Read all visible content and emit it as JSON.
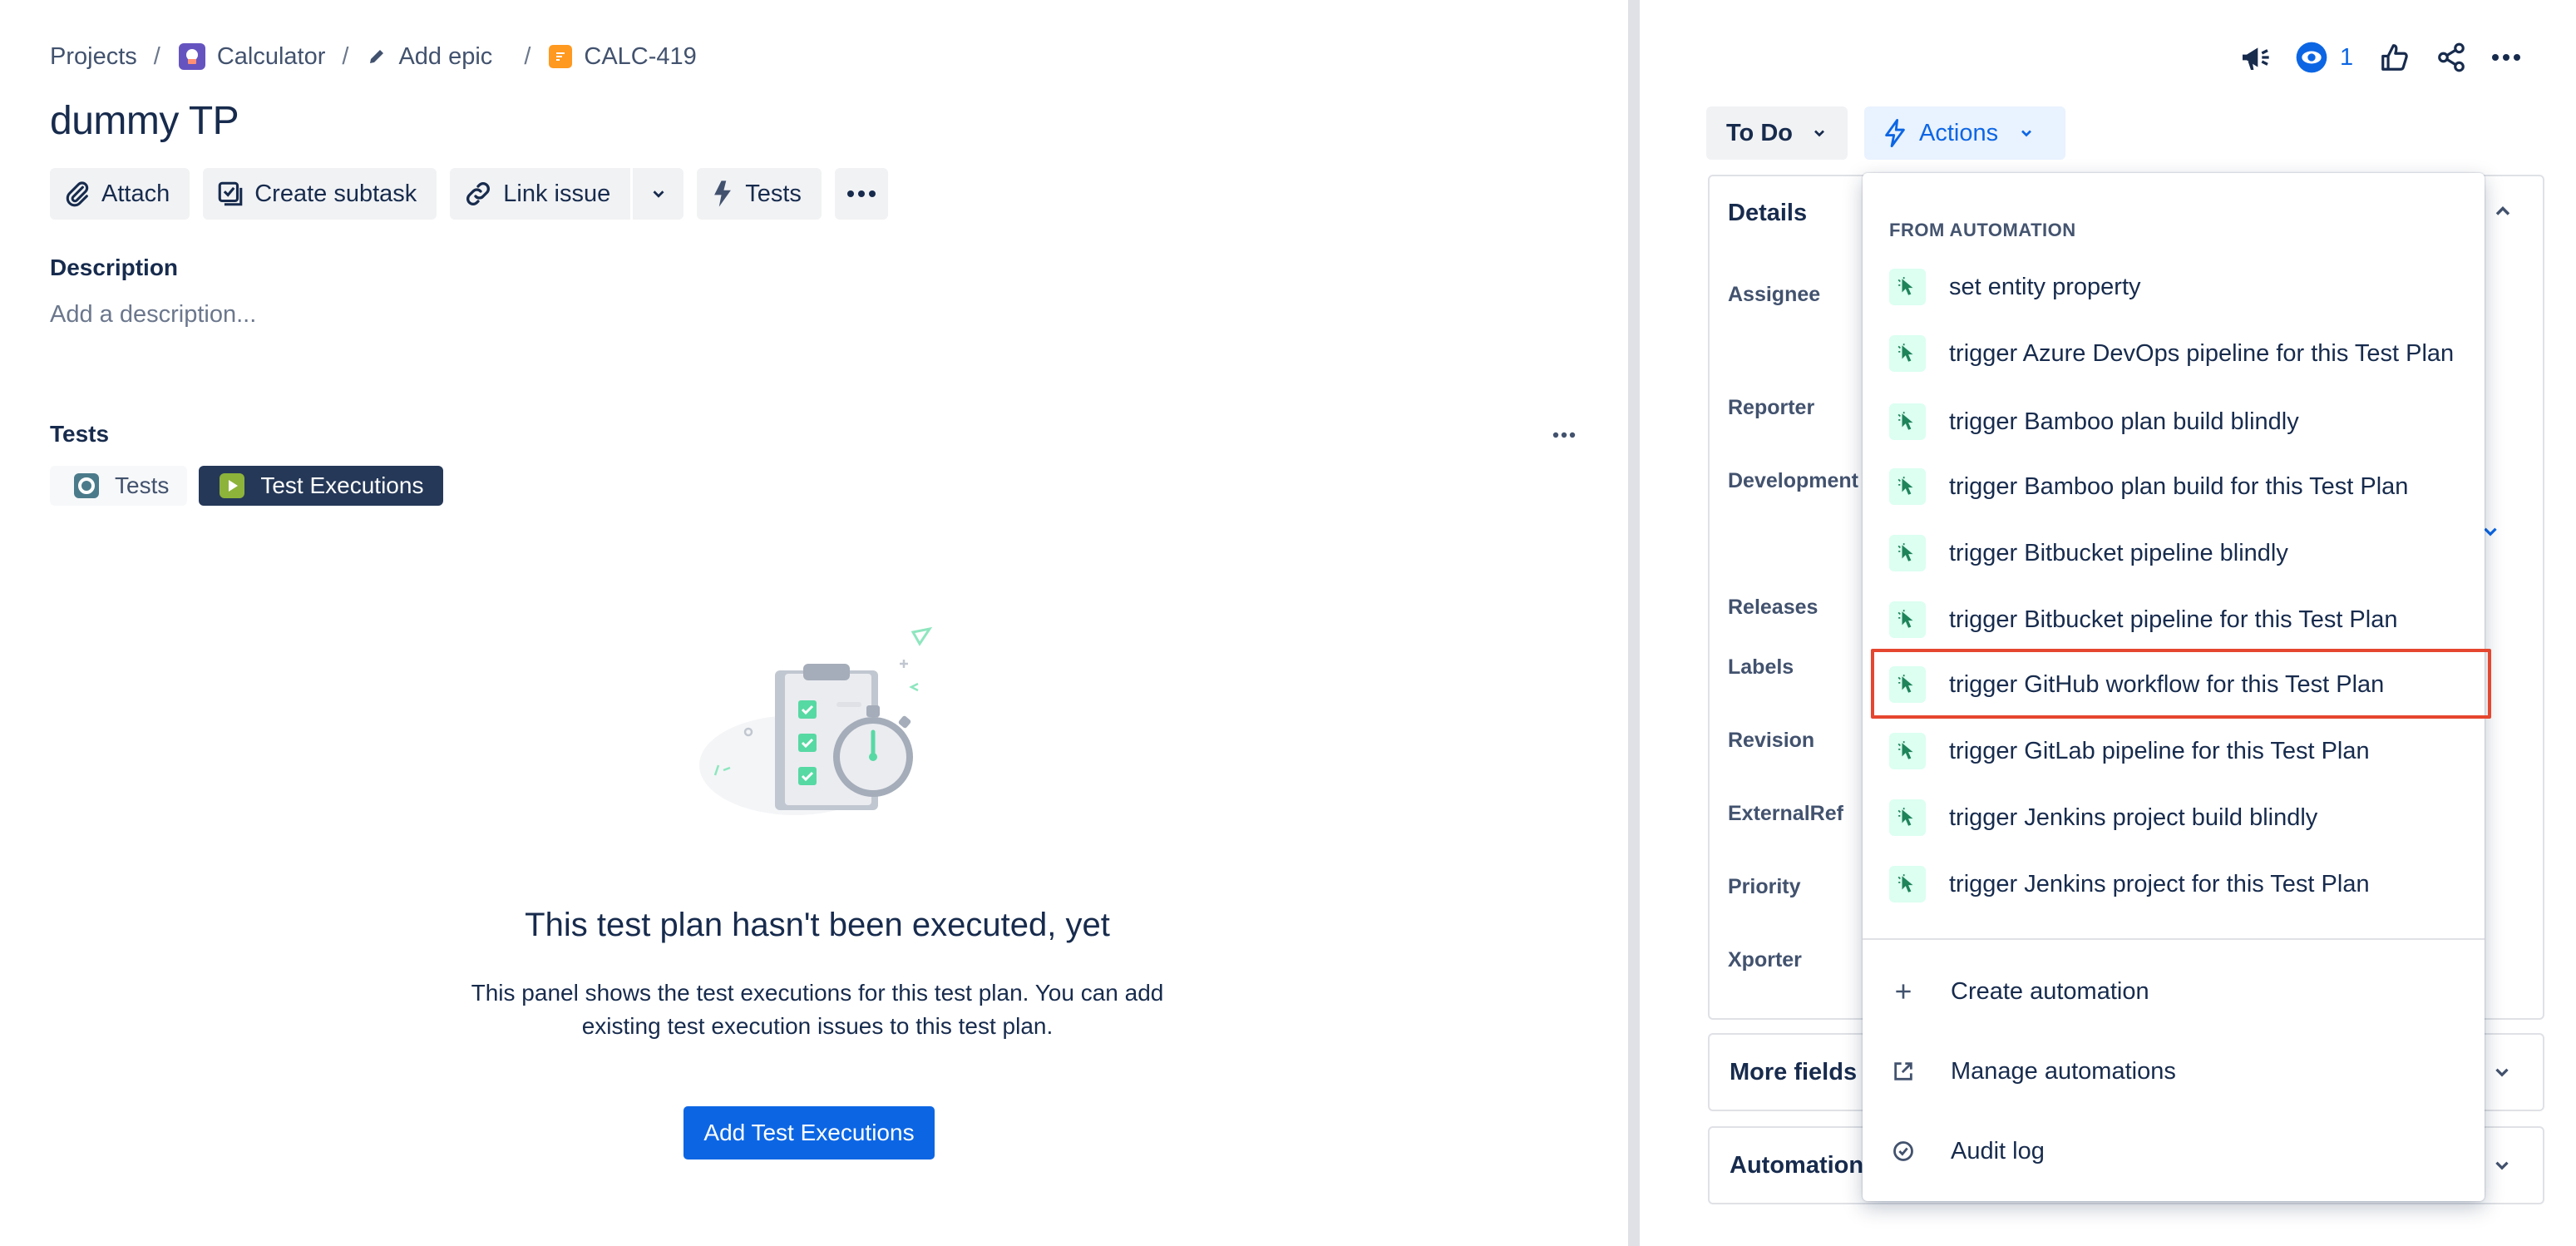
{
  "breadcrumb": {
    "projects": "Projects",
    "project": "Calculator",
    "epic": "Add epic",
    "issue_key": "CALC-419",
    "separator": "/"
  },
  "issue": {
    "title": "dummy TP"
  },
  "toolbar": {
    "attach": "Attach",
    "create_subtask": "Create subtask",
    "link_issue": "Link issue",
    "tests": "Tests"
  },
  "description": {
    "label": "Description",
    "placeholder": "Add a description..."
  },
  "tests_section": {
    "label": "Tests",
    "tabs": [
      {
        "label": "Tests",
        "active": false
      },
      {
        "label": "Test Executions",
        "active": true
      }
    ]
  },
  "empty_state": {
    "title": "This test plan hasn't been executed, yet",
    "body": "This panel shows the test executions for this test plan. You can add existing test execution issues to this test plan.",
    "button": "Add Test Executions"
  },
  "top_actions": {
    "watch_count": "1",
    "icons": [
      "megaphone-icon",
      "eye-icon",
      "thumbs-up-icon",
      "share-icon",
      "more-icon"
    ]
  },
  "status": {
    "label": "To Do",
    "actions_label": "Actions"
  },
  "details": {
    "heading": "Details",
    "fields": [
      "Assignee",
      "Reporter",
      "Development",
      "Releases",
      "Labels",
      "Revision",
      "ExternalRef",
      "Priority",
      "Xporter"
    ],
    "more_fields": "More fields",
    "automation": "Automation"
  },
  "menu": {
    "heading": "FROM AUTOMATION",
    "items": [
      "set entity property",
      "trigger Azure DevOps pipeline for this Test Plan",
      "trigger Bamboo plan build blindly",
      "trigger Bamboo plan build for this Test Plan",
      "trigger Bitbucket pipeline blindly",
      "trigger Bitbucket pipeline for this Test Plan",
      "trigger GitHub workflow for this Test Plan",
      "trigger GitLab pipeline for this Test Plan",
      "trigger Jenkins project build blindly",
      "trigger Jenkins project for this Test Plan"
    ],
    "highlighted_item": "trigger GitHub workflow for this Test Plan",
    "footer": {
      "create": "Create automation",
      "manage": "Manage automations",
      "audit": "Audit log"
    }
  },
  "colors": {
    "primary": "#0c66e4",
    "active_tab": "#253858",
    "highlight": "#e5462f",
    "automation_icon_bg": "#dcfff1"
  }
}
